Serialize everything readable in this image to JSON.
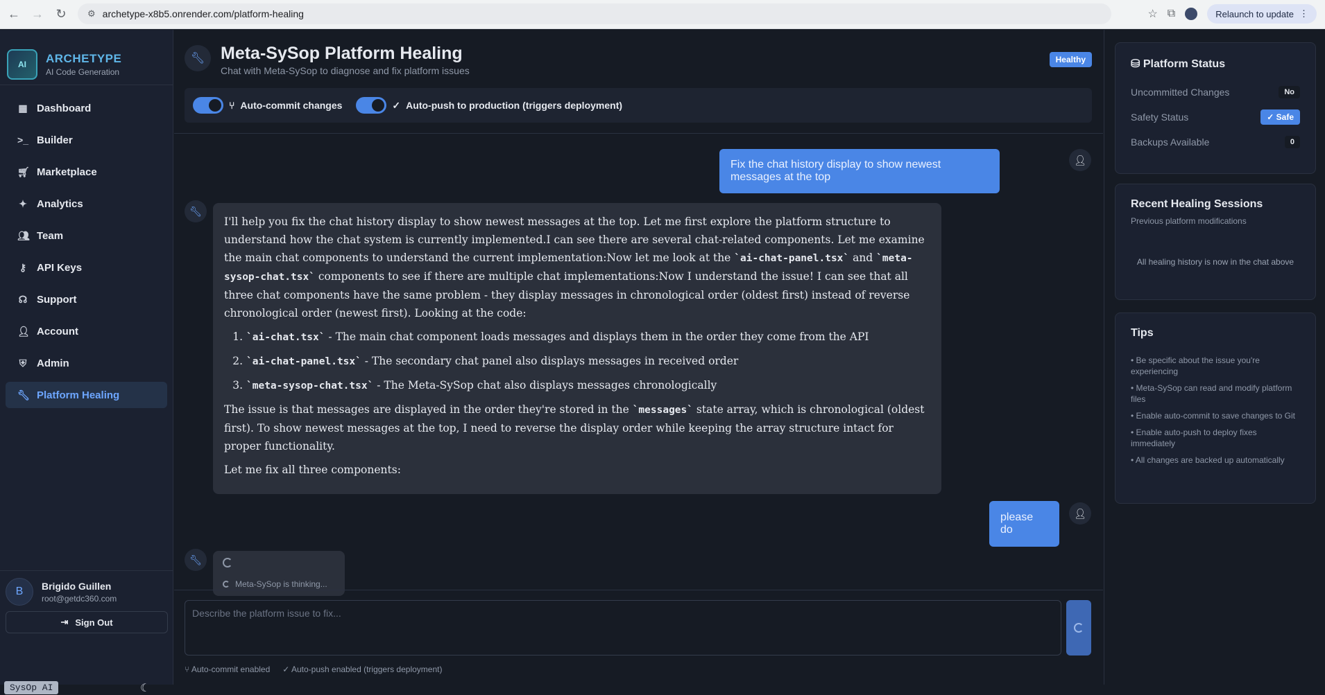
{
  "browser": {
    "url": "archetype-x8b5.onrender.com/platform-healing",
    "relaunch": "Relaunch to update"
  },
  "brand": {
    "name": "ARCHETYPE",
    "tagline": "AI Code Generation",
    "logo_text": "AI"
  },
  "nav": [
    {
      "label": "Dashboard",
      "icon": "grid-icon"
    },
    {
      "label": "Builder",
      "icon": "terminal-icon"
    },
    {
      "label": "Marketplace",
      "icon": "cart-icon"
    },
    {
      "label": "Analytics",
      "icon": "sparkle-icon"
    },
    {
      "label": "Team",
      "icon": "users-icon"
    },
    {
      "label": "API Keys",
      "icon": "key-icon"
    },
    {
      "label": "Support",
      "icon": "headset-icon"
    },
    {
      "label": "Account",
      "icon": "user-icon"
    },
    {
      "label": "Admin",
      "icon": "shield-icon"
    },
    {
      "label": "Platform Healing",
      "icon": "wrench-icon",
      "active": true
    }
  ],
  "user": {
    "initial": "B",
    "name": "Brigido Guillen",
    "email": "root@getdc360.com",
    "signout": "Sign Out"
  },
  "footer_badge": "SysOp AI",
  "header": {
    "title": "Meta-SySop Platform Healing",
    "subtitle": "Chat with Meta-SySop to diagnose and fix platform issues",
    "status": "Healthy"
  },
  "toggles": {
    "autocommit": "Auto-commit changes",
    "autopush": "Auto-push to production (triggers deployment)"
  },
  "chat": {
    "user1": "Fix the chat history display to show newest messages at the top",
    "assistant": {
      "p1a": "I'll help you fix the chat history display to show newest messages at the top. Let me first explore the platform structure to understand how the chat system is currently implemented.I can see there are several chat-related components. Let me examine the main chat components to understand the current implementation:Now let me look at the ",
      "c1": "`ai-chat-panel.tsx`",
      "p1b": " and ",
      "c2": "`meta-sysop-chat.tsx`",
      "p1c": " components to see if there are multiple chat implementations:Now I understand the issue! I can see that all three chat components have the same problem - they display messages in chronological order (oldest first) instead of reverse chronological order (newest first). Looking at the code:",
      "items": [
        {
          "code": "`ai-chat.tsx`",
          "text": " - The main chat component loads messages and displays them in the order they come from the API"
        },
        {
          "code": "`ai-chat-panel.tsx`",
          "text": " - The secondary chat panel also displays messages in received order"
        },
        {
          "code": "`meta-sysop-chat.tsx`",
          "text": " - The Meta-SySop chat also displays messages chronologically"
        }
      ],
      "p2a": "The issue is that messages are displayed in the order they're stored in the ",
      "c3": "`messages`",
      "p2b": " state array, which is chronological (oldest first). To show newest messages at the top, I need to reverse the display order while keeping the array structure intact for proper functionality.",
      "p3": "Let me fix all three components:"
    },
    "user2": "please do",
    "thinking": "Meta-SySop is thinking..."
  },
  "composer": {
    "placeholder": "Describe the platform issue to fix...",
    "foot1": "Auto-commit enabled",
    "foot2": "Auto-push enabled (triggers deployment)"
  },
  "status": {
    "title": "Platform Status",
    "rows": [
      {
        "label": "Uncommitted Changes",
        "value": "No"
      },
      {
        "label": "Safety Status",
        "value": "Safe"
      },
      {
        "label": "Backups Available",
        "value": "0"
      }
    ]
  },
  "sessions": {
    "title": "Recent Healing Sessions",
    "sub": "Previous platform modifications",
    "empty": "All healing history is now in the chat above"
  },
  "tips": {
    "title": "Tips",
    "items": [
      "• Be specific about the issue you're experiencing",
      "• Meta-SySop can read and modify platform files",
      "• Enable auto-commit to save changes to Git",
      "• Enable auto-push to deploy fixes immediately",
      "• All changes are backed up automatically"
    ]
  },
  "colors": {
    "accent": "#4a86e6",
    "bg": "#161b24",
    "sidebar": "#1b2130"
  }
}
